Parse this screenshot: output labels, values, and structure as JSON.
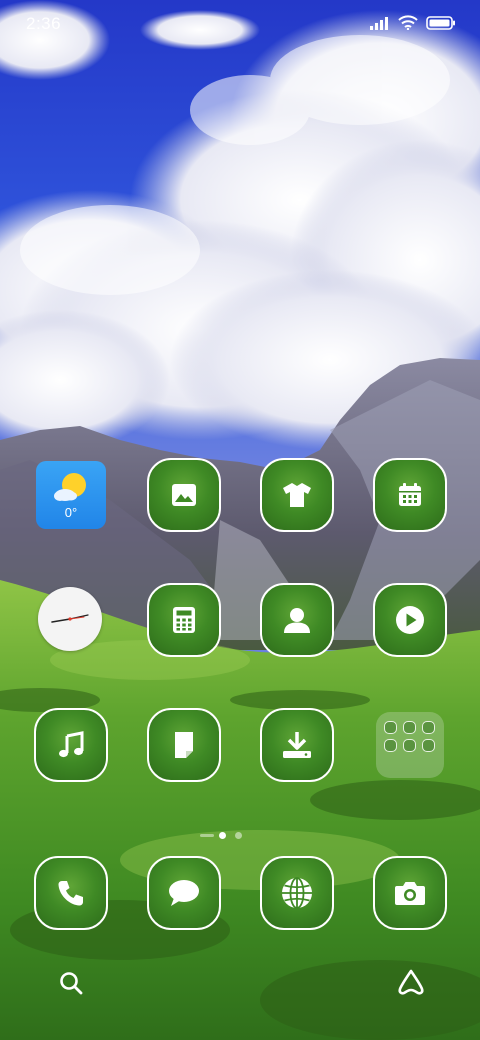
{
  "status_bar": {
    "time": "2:36",
    "signal_icon": "cellular-signal-icon",
    "wifi_icon": "wifi-icon",
    "battery_icon": "battery-icon"
  },
  "widgets": {
    "weather": {
      "icon": "partly-cloudy-icon",
      "temperature": "0°"
    },
    "clock": {
      "icon": "analog-clock-icon"
    }
  },
  "apps": {
    "row1": [
      "gallery-icon",
      "theme-shirt-icon",
      "calendar-icon"
    ],
    "row2": [
      "calculator-icon",
      "contacts-icon",
      "video-play-icon"
    ],
    "row3": [
      "music-note-icon",
      "notes-icon",
      "download-icon"
    ],
    "dock": [
      "phone-icon",
      "messages-icon",
      "browser-globe-icon",
      "camera-icon"
    ]
  },
  "folder": {
    "icon": "app-folder-icon",
    "item_count": 6
  },
  "pager": {
    "pages": 3,
    "current": 2
  },
  "bottom": {
    "search_icon": "search-icon",
    "assistant_icon": "assistant-icon"
  },
  "colors": {
    "sky": "#2a4fd8",
    "grass": "#4a9a28",
    "weather_bg": "#2a90ef"
  }
}
